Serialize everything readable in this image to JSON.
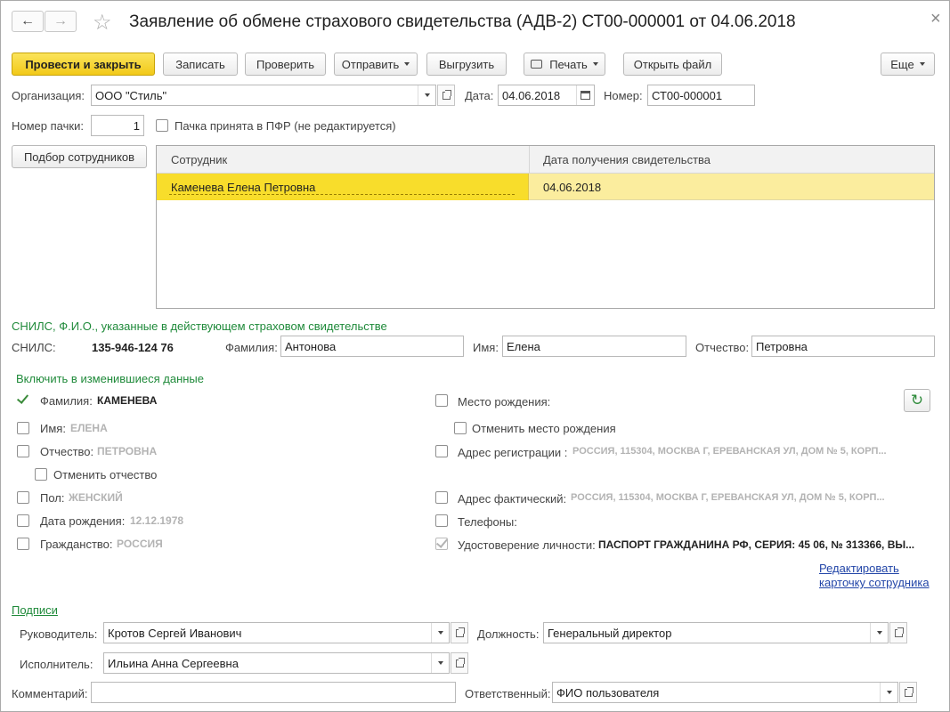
{
  "window": {
    "title": "Заявление об обмене страхового свидетельства (АДВ-2) СТ00-000001 от 04.06.2018",
    "close_glyph": "×"
  },
  "nav": {
    "back_glyph": "←",
    "forward_glyph": "→",
    "favorite_glyph": "☆"
  },
  "toolbar": {
    "post_close": "Провести и закрыть",
    "save": "Записать",
    "check": "Проверить",
    "send": "Отправить",
    "export": "Выгрузить",
    "print": "Печать",
    "open_file": "Открыть файл",
    "more": "Еще"
  },
  "header": {
    "org_label": "Организация:",
    "org_value": "ООО \"Стиль\"",
    "date_label": "Дата:",
    "date_value": "04.06.2018",
    "number_label": "Номер:",
    "number_value": "СТ00-000001",
    "batch_label": "Номер пачки:",
    "batch_value": "1",
    "accepted_label": "Пачка принята в ПФР (не редактируется)"
  },
  "employees": {
    "pick_button": "Подбор сотрудников",
    "columns": [
      "Сотрудник",
      "Дата получения свидетельства"
    ],
    "rows": [
      {
        "employee": "Каменева Елена Петровна",
        "date": "04.06.2018"
      }
    ]
  },
  "current": {
    "section_title": "СНИЛС, Ф.И.О., указанные в действующем страховом свидетельстве",
    "snils_label": "СНИЛС:",
    "snils_value": "135-946-124 76",
    "surname_label": "Фамилия:",
    "surname_value": "Антонова",
    "name_label": "Имя:",
    "name_value": "Елена",
    "patronymic_label": "Отчество:",
    "patronymic_value": "Петровна"
  },
  "changes": {
    "section_title": "Включить в изменившиеся данные",
    "surname": {
      "label": "Фамилия:",
      "value": "КАМЕНЕВА",
      "checked": true
    },
    "name": {
      "label": "Имя:",
      "value": "ЕЛЕНА"
    },
    "patronymic": {
      "label": "Отчество:",
      "value": "ПЕТРОВНА"
    },
    "cancel_patronymic": "Отменить отчество",
    "gender": {
      "label": "Пол:",
      "value": "ЖЕНСКИЙ"
    },
    "birthdate": {
      "label": "Дата рождения:",
      "value": "12.12.1978"
    },
    "citizenship": {
      "label": "Гражданство:",
      "value": "РОССИЯ"
    },
    "birthplace": {
      "label": "Место рождения:"
    },
    "cancel_birthplace": "Отменить место рождения",
    "reg_address": {
      "label": "Адрес регистрации :",
      "value": "РОССИЯ, 115304, МОСКВА Г, ЕРЕВАНСКАЯ УЛ, ДОМ № 5, КОРП..."
    },
    "fact_address": {
      "label": "Адрес фактический:",
      "value": "РОССИЯ, 115304, МОСКВА Г, ЕРЕВАНСКАЯ УЛ, ДОМ № 5, КОРП..."
    },
    "phones": {
      "label": "Телефоны:"
    },
    "identity": {
      "label": "Удостоверение личности:",
      "value": "ПАСПОРТ ГРАЖДАНИНА РФ, СЕРИЯ: 45 06, № 313366, ВЫ..."
    },
    "edit_link_line1": "Редактировать",
    "edit_link_line2": "карточку сотрудника",
    "refresh_glyph": "↻"
  },
  "signatures": {
    "section_title": "Подписи",
    "head_label": "Руководитель:",
    "head_value": "Кротов Сергей Иванович",
    "position_label": "Должность:",
    "position_value": "Генеральный директор",
    "executor_label": "Исполнитель:",
    "executor_value": "Ильина Анна Сергеевна"
  },
  "footer": {
    "comment_label": "Комментарий:",
    "comment_value": "",
    "responsible_label": "Ответственный:",
    "responsible_value": "ФИО пользователя"
  },
  "colors": {
    "accent": "#f2c919",
    "section": "#1f8a3a",
    "link": "#2346a8",
    "selected_row": "#fbed9e"
  }
}
